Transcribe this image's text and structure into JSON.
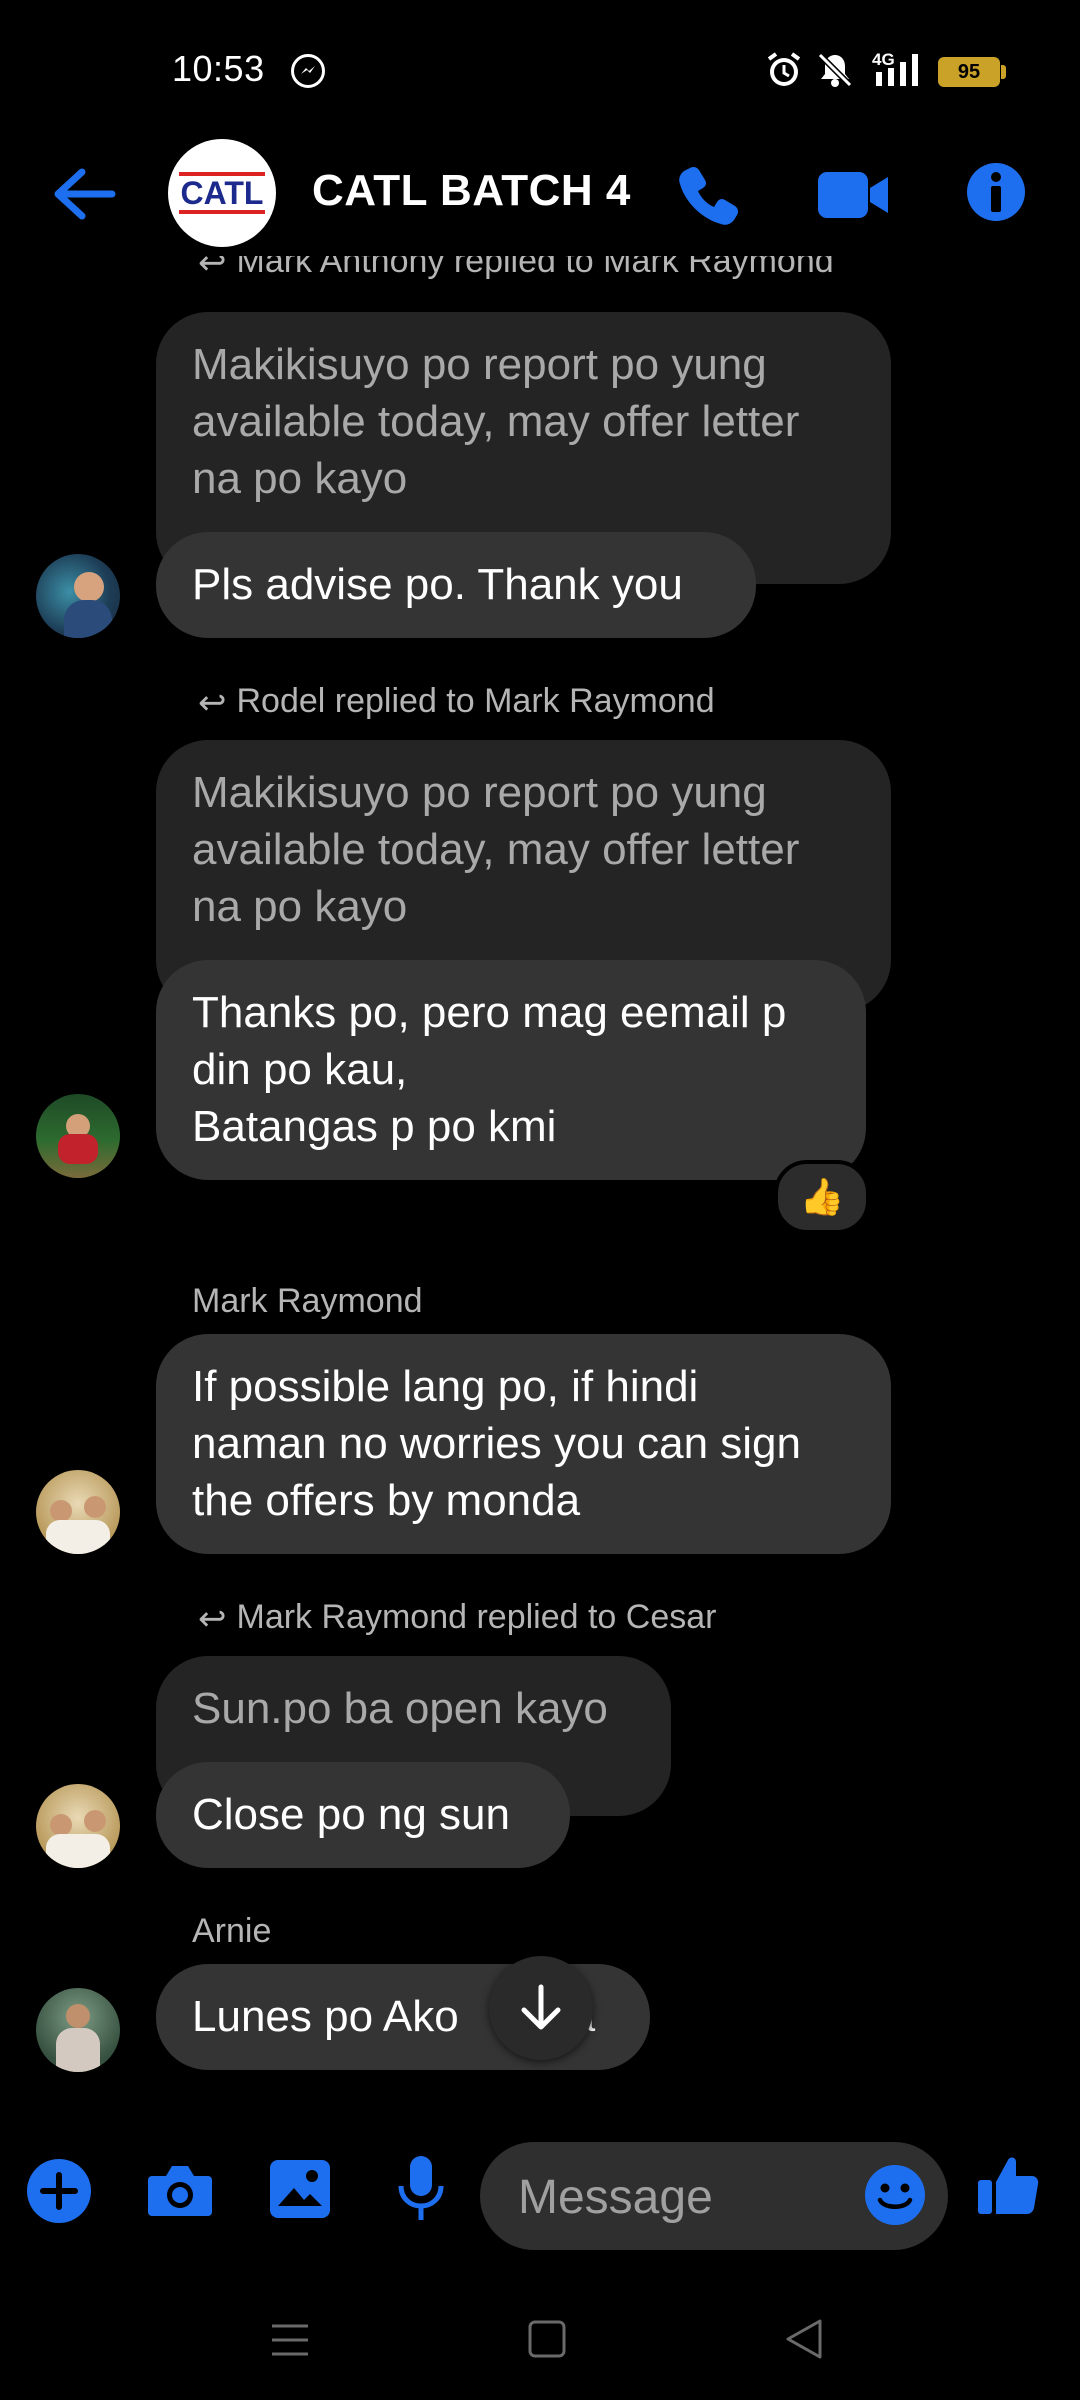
{
  "status_bar": {
    "time": "10:53",
    "battery": "95",
    "network": "4G"
  },
  "header": {
    "logo_text": "CATL",
    "title": "CATL BATCH 4"
  },
  "messages": {
    "m1": {
      "reply_note": "Mark Anthony replied to Mark Raymond",
      "quoted": "Makikisuyo po report po yung available today, may offer letter na po kayo",
      "text": "Pls advise po. Thank you"
    },
    "m2": {
      "reply_note": "Rodel replied to Mark Raymond",
      "quoted": "Makikisuyo po report po yung available today, may offer letter na po kayo",
      "text_lines": [
        "Thanks po, pero mag eemail p",
        "din po kau,",
        "Batangas p po kmi"
      ],
      "reaction": "👍"
    },
    "m3": {
      "sender": "Mark Raymond",
      "text_lines": [
        "If possible lang po, if hindi",
        "naman no worries you can sign",
        "the offers by monda"
      ]
    },
    "m4": {
      "reply_note": "Mark Raymond replied to Cesar",
      "quoted": "Sun.po ba open kayo",
      "text": "Close po ng sun"
    },
    "m5": {
      "sender": "Arnie",
      "text_left": "Lunes po Ako",
      "text_right": "a"
    }
  },
  "composer": {
    "placeholder": "Message"
  },
  "colors": {
    "accent": "#1e6ff0",
    "bubble": "#343434",
    "quoted_bubble": "#242424",
    "background": "#000000"
  }
}
